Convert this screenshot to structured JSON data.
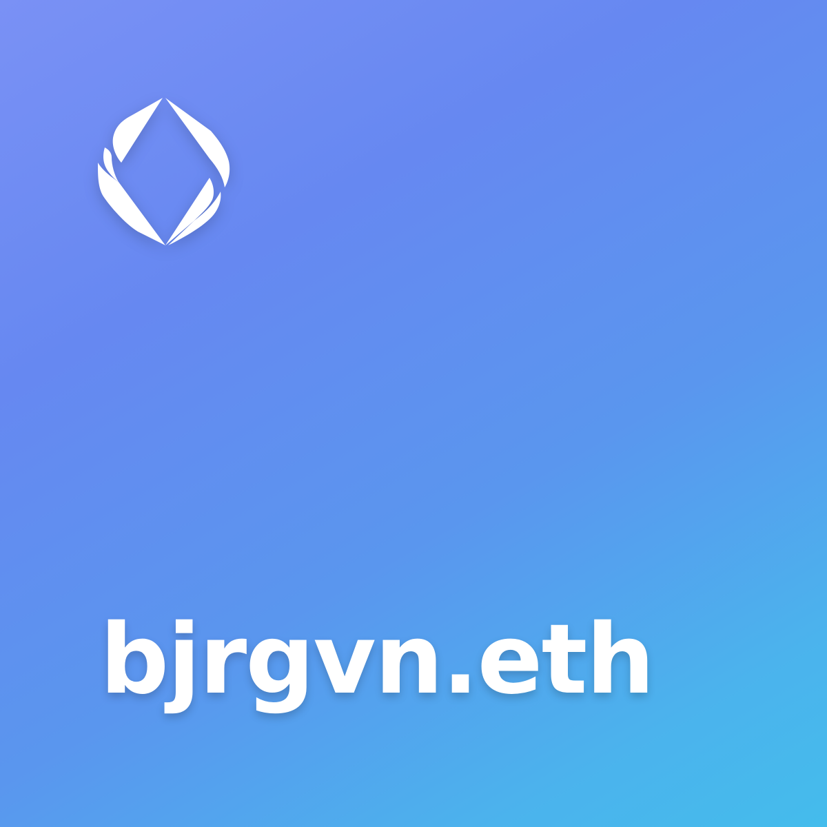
{
  "card": {
    "logo_icon": "ens-logo-icon",
    "domain_name": "bjrgvn.eth",
    "gradient_colors": [
      "#7a91f5",
      "#6688f1",
      "#5a96ee",
      "#4bb3ed",
      "#44bcec"
    ],
    "text_color": "#ffffff"
  }
}
